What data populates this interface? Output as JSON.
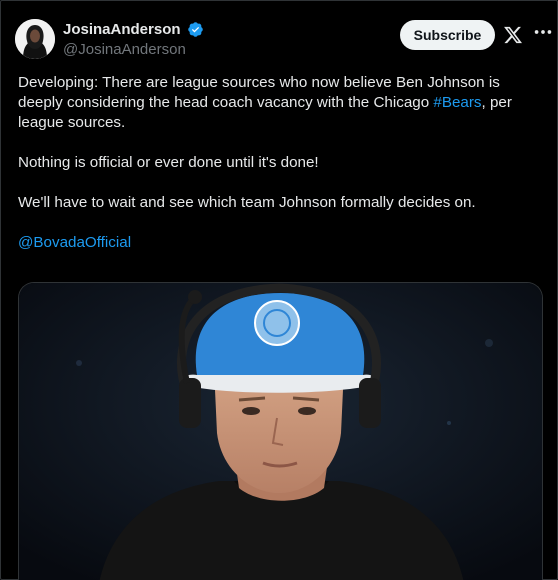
{
  "author": {
    "display_name": "JosinaAnderson",
    "handle": "@JosinaAnderson"
  },
  "header": {
    "subscribe_label": "Subscribe"
  },
  "tweet": {
    "para1_before": "Developing: There are league sources who now believe Ben Johnson is deeply considering the head coach vacancy with the Chicago ",
    "para1_hashtag": "#Bears",
    "para1_after": ", per league sources.",
    "para2": "Nothing is official or ever done until it's done!",
    "para3": "We'll have to wait and see which team Johnson formally decides on.",
    "mention": "@BovadaOfficial"
  },
  "colors": {
    "background": "#000000",
    "link": "#1d9bf0",
    "verified_badge": "#1d9bf0",
    "subscribe_bg": "#eff3f4"
  },
  "icons": [
    "verified-badge-icon",
    "x-logo-icon",
    "more-options-icon"
  ]
}
